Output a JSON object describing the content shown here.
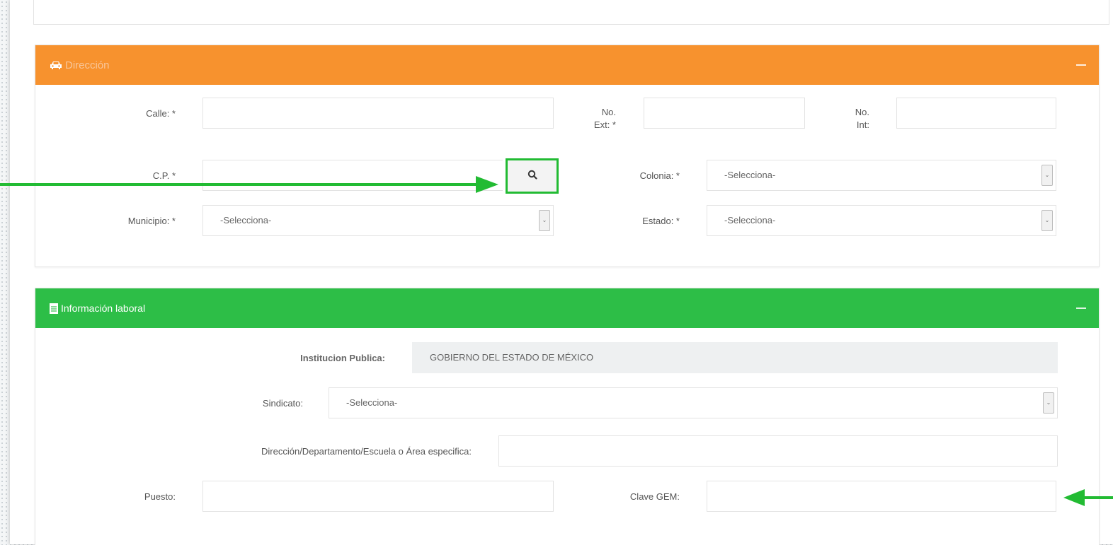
{
  "colors": {
    "address_header": "#f7922e",
    "labor_header": "#2dbe47",
    "highlight": "#22bb33"
  },
  "address_panel": {
    "title": "Dirección",
    "icon": "car-icon",
    "labels": {
      "calle": "Calle: *",
      "no_ext_line1": "No.",
      "no_ext_line2": "Ext: *",
      "no_int_line1": "No.",
      "no_int_line2": "Int:",
      "cp": "C.P. *",
      "colonia": "Colonia: *",
      "municipio": "Municipio: *",
      "estado": "Estado: *"
    },
    "values": {
      "calle": "",
      "no_ext": "",
      "no_int": "",
      "cp": ""
    },
    "selects": {
      "colonia": "-Selecciona-",
      "municipio": "-Selecciona-",
      "estado": "-Selecciona-"
    },
    "search_icon": "search-icon"
  },
  "labor_panel": {
    "title": "Información laboral",
    "icon": "document-icon",
    "labels": {
      "institucion": "Institucion Publica:",
      "sindicato": "Sindicato:",
      "area": "Dirección/Departamento/Escuela o Área especifica:",
      "puesto": "Puesto:",
      "clave_gem": "Clave GEM:"
    },
    "values": {
      "institucion": "GOBIERNO DEL ESTADO DE MÉXICO",
      "area": "",
      "puesto": "",
      "clave_gem": ""
    },
    "selects": {
      "sindicato": "-Selecciona-"
    }
  }
}
